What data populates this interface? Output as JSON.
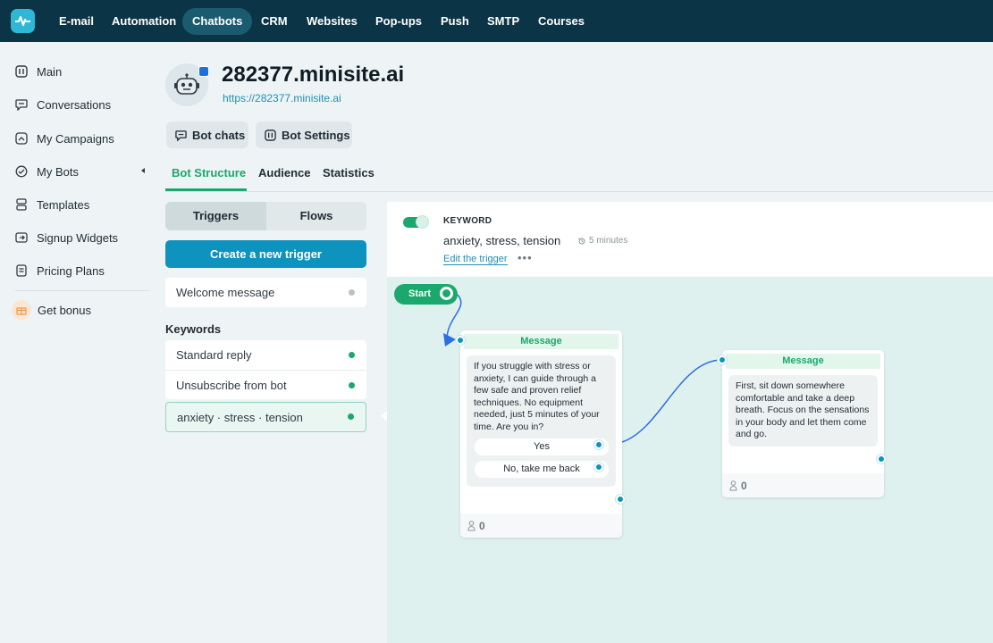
{
  "topnav": {
    "items": [
      "E-mail",
      "Automation",
      "Chatbots",
      "CRM",
      "Websites",
      "Pop-ups",
      "Push",
      "SMTP",
      "Courses"
    ],
    "active": "Chatbots"
  },
  "sidebar": {
    "items": [
      {
        "label": "Main",
        "icon": "dashboard-icon"
      },
      {
        "label": "Conversations",
        "icon": "chat-icon"
      },
      {
        "label": "My Campaigns",
        "icon": "campaign-icon"
      },
      {
        "label": "My Bots",
        "icon": "bot-icon"
      },
      {
        "label": "Templates",
        "icon": "templates-icon"
      },
      {
        "label": "Signup Widgets",
        "icon": "widget-icon"
      },
      {
        "label": "Pricing Plans",
        "icon": "pricing-icon"
      }
    ],
    "bonus": "Get bonus"
  },
  "header": {
    "title": "282377.minisite.ai",
    "url": "https://282377.minisite.ai",
    "bot_chats": "Bot chats",
    "bot_settings": "Bot Settings"
  },
  "tabs": [
    "Bot Structure",
    "Audience",
    "Statistics"
  ],
  "panel": {
    "segments": [
      "Triggers",
      "Flows"
    ],
    "create_trigger": "Create a new trigger",
    "welcome": "Welcome message",
    "keywords_heading": "Keywords",
    "keyword_items": [
      "Standard reply",
      "Unsubscribe from bot",
      "anxiety · stress · tension"
    ]
  },
  "trigger": {
    "type": "KEYWORD",
    "words": "anxiety, stress, tension",
    "time": "5 minutes",
    "edit": "Edit the trigger",
    "more": "•••"
  },
  "flow": {
    "start": "Start",
    "card1": {
      "head": "Message",
      "text": "If you struggle with stress or anxiety, I can guide through a few safe and proven relief techniques. No equipment needed, just 5 minutes of your time. Are you in?",
      "buttons": [
        "Yes",
        "No, take me back"
      ],
      "count": "0"
    },
    "card2": {
      "head": "Message",
      "text": "First, sit down somewhere comfortable and take a deep breath. Focus on the sensations in your body and let them come and go.",
      "count": "0"
    }
  },
  "colors": {
    "topbar": "#0b3446",
    "accent_green": "#1aa86c",
    "accent_blue": "#0e93bf",
    "canvas": "#dff1ef"
  }
}
